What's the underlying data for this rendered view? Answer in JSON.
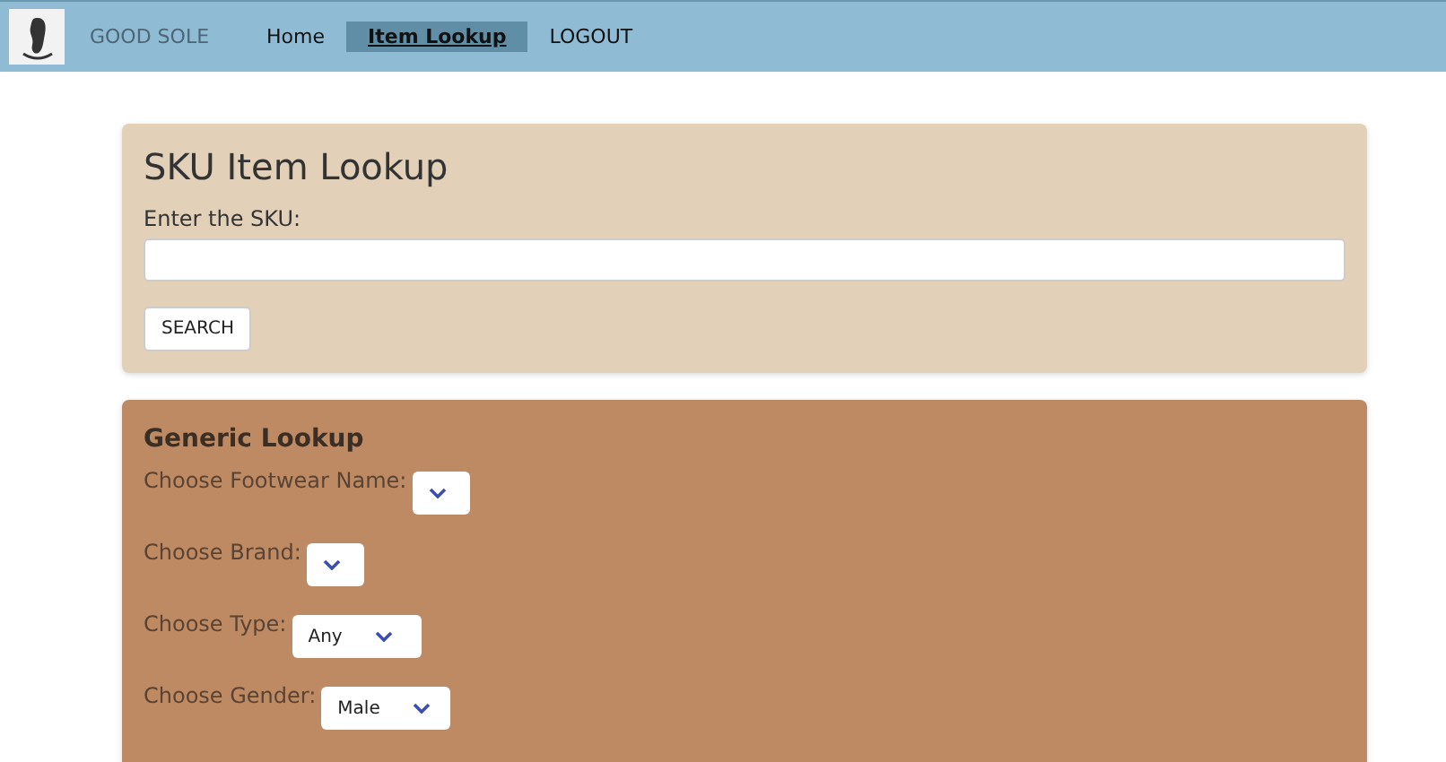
{
  "nav": {
    "brand": "GOOD SOLE",
    "links": [
      {
        "label": "Home",
        "selected": false
      },
      {
        "label": "Item Lookup",
        "selected": true
      },
      {
        "label": "LOGOUT",
        "selected": false
      }
    ]
  },
  "sku_lookup": {
    "title": "SKU Item Lookup",
    "label": "Enter the SKU:",
    "button": "SEARCH"
  },
  "generic_lookup": {
    "title": "Generic Lookup",
    "fields": [
      {
        "label": "Choose Footwear Name:"
      },
      {
        "label": "Choose Brand:"
      },
      {
        "label": "Choose Type:",
        "value": "Any"
      },
      {
        "label": "Choose Gender:",
        "value": "Male"
      }
    ]
  }
}
